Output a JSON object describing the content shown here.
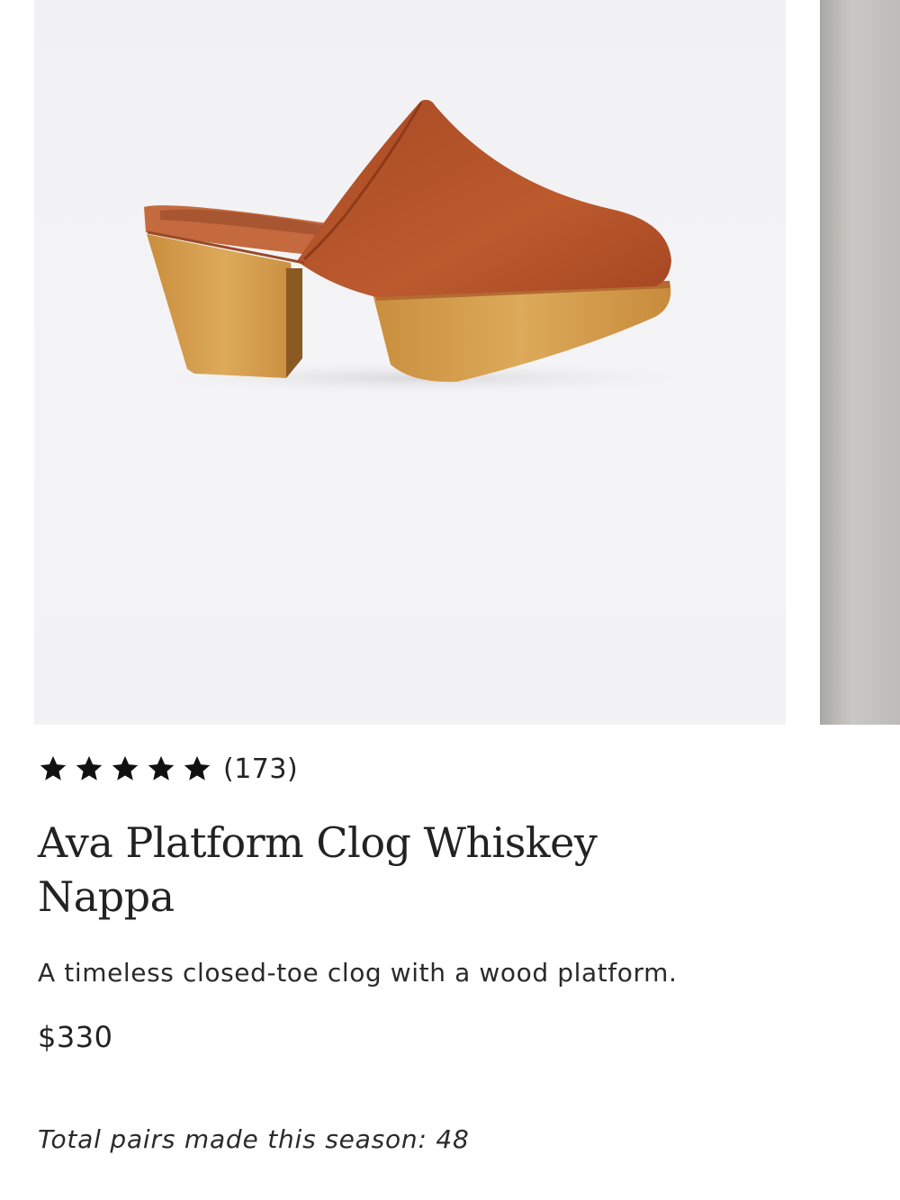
{
  "product": {
    "rating_stars": 5,
    "review_count": "(173)",
    "title": "Ava Platform Clog Whiskey Nappa",
    "description": "A timeless closed-toe clog with a wood platform.",
    "price": "$330",
    "pairs_made": "Total pairs made this season: 48"
  },
  "colors": {
    "leather": "#b5532c",
    "wood": "#d9a34f",
    "star": "#111111"
  },
  "icons": {
    "star": "star-icon"
  }
}
